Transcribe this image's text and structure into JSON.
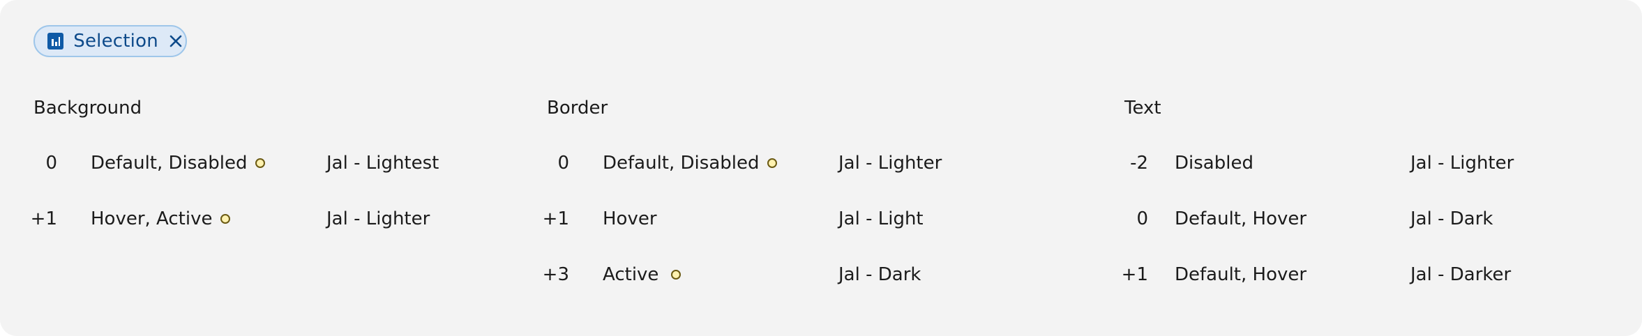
{
  "chip": {
    "label": "Selection",
    "icon": "bar-chart-icon",
    "close_icon": "close-icon"
  },
  "columns": [
    {
      "title": "Background",
      "rows": [
        {
          "level": "0",
          "state": "Default, Disabled",
          "indicator": true,
          "token": "Jal - Lightest"
        },
        {
          "level": "+1",
          "state": "Hover, Active",
          "indicator": true,
          "token": "Jal - Lighter"
        }
      ]
    },
    {
      "title": "Border",
      "rows": [
        {
          "level": "0",
          "state": "Default, Disabled",
          "indicator": true,
          "token": "Jal - Lighter"
        },
        {
          "level": "+1",
          "state": "Hover",
          "indicator": false,
          "token": "Jal - Light"
        },
        {
          "level": "+3",
          "state": "Active",
          "indicator": true,
          "token": "Jal - Dark"
        }
      ]
    },
    {
      "title": "Text",
      "rows": [
        {
          "level": "-2",
          "state": "Disabled",
          "indicator": false,
          "token": "Jal - Lighter"
        },
        {
          "level": "0",
          "state": "Default, Hover",
          "indicator": false,
          "token": "Jal - Dark"
        },
        {
          "level": "+1",
          "state": "Default, Hover",
          "indicator": false,
          "token": "Jal - Darker"
        }
      ]
    }
  ],
  "colors": {
    "panel_background": "#f3f3f3",
    "chip_background": "#dde9f7",
    "chip_border": "#9ec6ea",
    "chip_text": "#0d4a8a",
    "indicator_fill": "#fff2b0",
    "indicator_stroke": "#6b5a13"
  }
}
